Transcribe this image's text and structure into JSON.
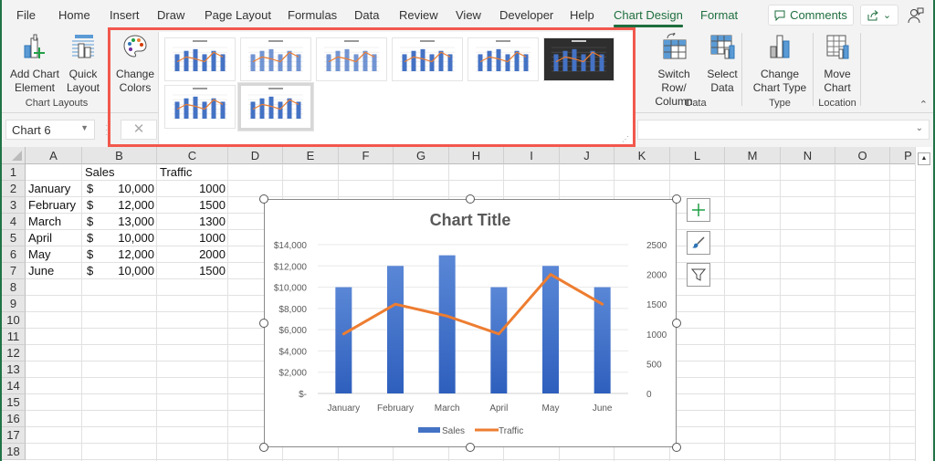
{
  "menu": {
    "tabs": [
      "File",
      "Home",
      "Insert",
      "Draw",
      "Page Layout",
      "Formulas",
      "Data",
      "Review",
      "View",
      "Developer",
      "Help",
      "Chart Design",
      "Format"
    ],
    "active_tab": "Chart Design",
    "comments_label": "Comments"
  },
  "ribbon": {
    "add_chart_element": "Add Chart\nElement",
    "quick_layout": "Quick\nLayout",
    "chart_layouts_group": "Chart Layouts",
    "change_colors": "Change\nColors",
    "switch_row_column": "Switch Row/\nColumn",
    "select_data": "Select\nData",
    "data_group": "Data",
    "change_chart_type": "Change\nChart Type",
    "type_group": "Type",
    "move_chart": "Move\nChart",
    "location_group": "Location",
    "chart_styles": [
      "Style 1",
      "Style 2",
      "Style 3",
      "Style 4",
      "Style 5",
      "Style 6",
      "Style 7",
      "Style 8"
    ],
    "selected_style_index": 7
  },
  "formula_bar": {
    "name_box": "Chart 6",
    "formula": ""
  },
  "sheet": {
    "columns": [
      "A",
      "B",
      "C",
      "D",
      "E",
      "F",
      "G",
      "H",
      "I",
      "J",
      "K",
      "L",
      "M",
      "N",
      "O",
      "P"
    ],
    "rows": [
      "1",
      "2",
      "3",
      "4",
      "5",
      "6",
      "7",
      "8",
      "9",
      "10",
      "11",
      "12",
      "13",
      "14",
      "15",
      "16",
      "17",
      "18"
    ],
    "headers": {
      "B": "Sales",
      "C": "Traffic"
    },
    "data": [
      {
        "month": "January",
        "currency": "$",
        "sales": "10,000",
        "traffic": "1000"
      },
      {
        "month": "February",
        "currency": "$",
        "sales": "12,000",
        "traffic": "1500"
      },
      {
        "month": "March",
        "currency": "$",
        "sales": "13,000",
        "traffic": "1300"
      },
      {
        "month": "April",
        "currency": "$",
        "sales": "10,000",
        "traffic": "1000"
      },
      {
        "month": "May",
        "currency": "$",
        "sales": "12,000",
        "traffic": "2000"
      },
      {
        "month": "June",
        "currency": "$",
        "sales": "10,000",
        "traffic": "1500"
      }
    ]
  },
  "chart_data": {
    "type": "bar",
    "title": "Chart Title",
    "categories": [
      "January",
      "February",
      "March",
      "April",
      "May",
      "June"
    ],
    "series": [
      {
        "name": "Sales",
        "type": "bar",
        "axis": "left",
        "color": "#4472c4",
        "values": [
          10000,
          12000,
          13000,
          10000,
          12000,
          10000
        ]
      },
      {
        "name": "Traffic",
        "type": "line",
        "axis": "right",
        "color": "#ed7d31",
        "values": [
          1000,
          1500,
          1300,
          1000,
          2000,
          1500
        ]
      }
    ],
    "y_left": {
      "min": 0,
      "max": 14000,
      "ticks": [
        0,
        2000,
        4000,
        6000,
        8000,
        10000,
        12000,
        14000
      ],
      "tick_labels": [
        "$-",
        "$2,000",
        "$4,000",
        "$6,000",
        "$8,000",
        "$10,000",
        "$12,000",
        "$14,000"
      ]
    },
    "y_right": {
      "min": 0,
      "max": 2500,
      "ticks": [
        0,
        500,
        1000,
        1500,
        2000,
        2500
      ],
      "tick_labels": [
        "0",
        "500",
        "1000",
        "1500",
        "2000",
        "2500"
      ]
    },
    "grid": true,
    "legend": "bottom"
  },
  "chart_side_buttons": [
    "chart-elements",
    "chart-styles",
    "chart-filters"
  ]
}
